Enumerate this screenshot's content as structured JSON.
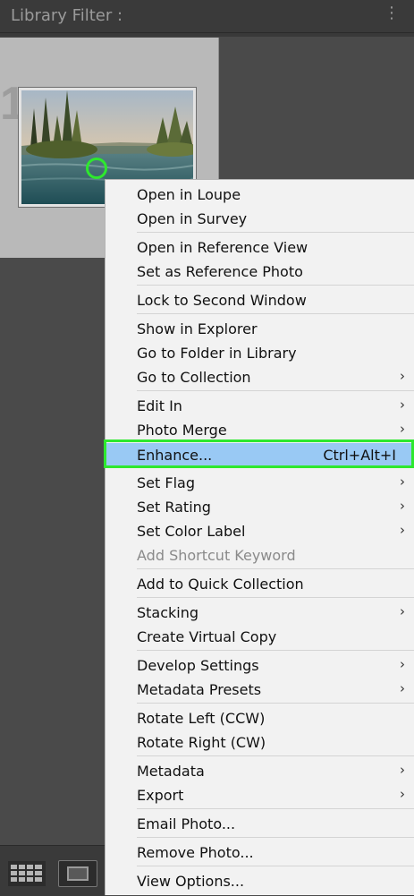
{
  "header": {
    "title": "Library Filter :",
    "menu_icon": "vertical-dots-icon"
  },
  "grid": {
    "cell_index": "1"
  },
  "menu": {
    "items": [
      {
        "label": "Open in Loupe"
      },
      {
        "label": "Open in Survey"
      },
      {
        "label": "Open in Reference View"
      },
      {
        "label": "Set as Reference Photo"
      },
      {
        "label": "Lock to Second Window"
      },
      {
        "label": "Show in Explorer"
      },
      {
        "label": "Go to Folder in Library"
      },
      {
        "label": "Go to Collection",
        "submenu": true
      },
      {
        "label": "Edit In",
        "submenu": true
      },
      {
        "label": "Photo Merge",
        "submenu": true
      },
      {
        "label": "Enhance...",
        "shortcut": "Ctrl+Alt+I",
        "highlighted": true
      },
      {
        "label": "Set Flag",
        "submenu": true
      },
      {
        "label": "Set Rating",
        "submenu": true
      },
      {
        "label": "Set Color Label",
        "submenu": true
      },
      {
        "label": "Add Shortcut Keyword",
        "disabled": true
      },
      {
        "label": "Add to Quick Collection"
      },
      {
        "label": "Stacking",
        "submenu": true
      },
      {
        "label": "Create Virtual Copy"
      },
      {
        "label": "Develop Settings",
        "submenu": true
      },
      {
        "label": "Metadata Presets",
        "submenu": true
      },
      {
        "label": "Rotate Left (CCW)"
      },
      {
        "label": "Rotate Right (CW)"
      },
      {
        "label": "Metadata",
        "submenu": true
      },
      {
        "label": "Export",
        "submenu": true
      },
      {
        "label": "Email Photo..."
      },
      {
        "label": "Remove Photo..."
      },
      {
        "label": "View Options..."
      }
    ],
    "submenu_glyph": "›",
    "highlight_color": "#99c9f4",
    "outline_color": "#2ee82e"
  },
  "toolbar": {
    "grid_icon": "grid-view-icon",
    "loupe_icon": "loupe-view-icon"
  }
}
